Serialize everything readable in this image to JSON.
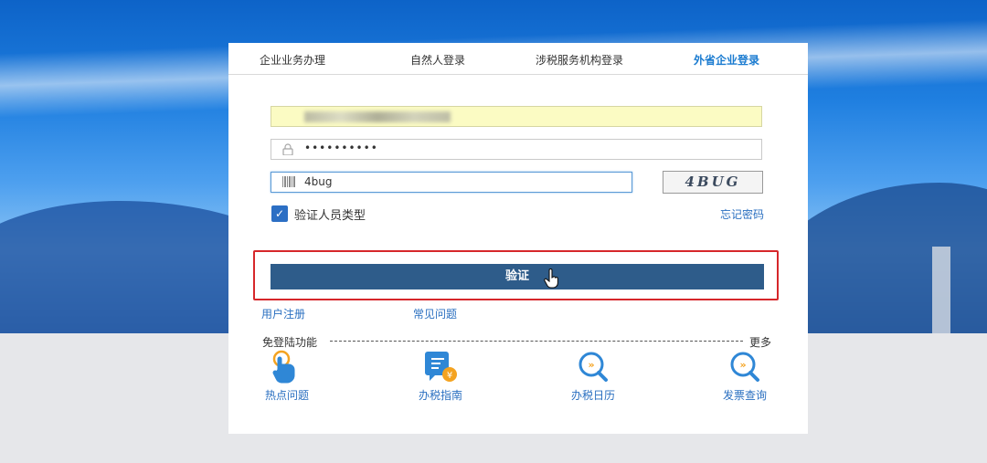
{
  "tabs": [
    "企业业务办理",
    "自然人登录",
    "涉税服务机构登录",
    "外省企业登录"
  ],
  "form": {
    "password_mask": "••••••••••",
    "captcha_value": "4bug",
    "captcha_image_text": "4BUG"
  },
  "remember": {
    "label": "验证人员类型",
    "checked": true
  },
  "forgot_label": "忘记密码",
  "verify_button_label": "验证",
  "links": {
    "register": "用户注册",
    "faq": "常见问题"
  },
  "quick": {
    "title": "免登陆功能",
    "more_label": "更多",
    "items": [
      {
        "label": "热点问题",
        "icon": "hand-pointer-icon"
      },
      {
        "label": "办税指南",
        "icon": "document-guide-icon"
      },
      {
        "label": "办税日历",
        "icon": "chat-search-icon"
      },
      {
        "label": "发票查询",
        "icon": "chat-search-icon"
      }
    ]
  },
  "colors": {
    "accent": "#1a7bd0",
    "button": "#2e5c8a",
    "highlight": "#d6272a"
  }
}
